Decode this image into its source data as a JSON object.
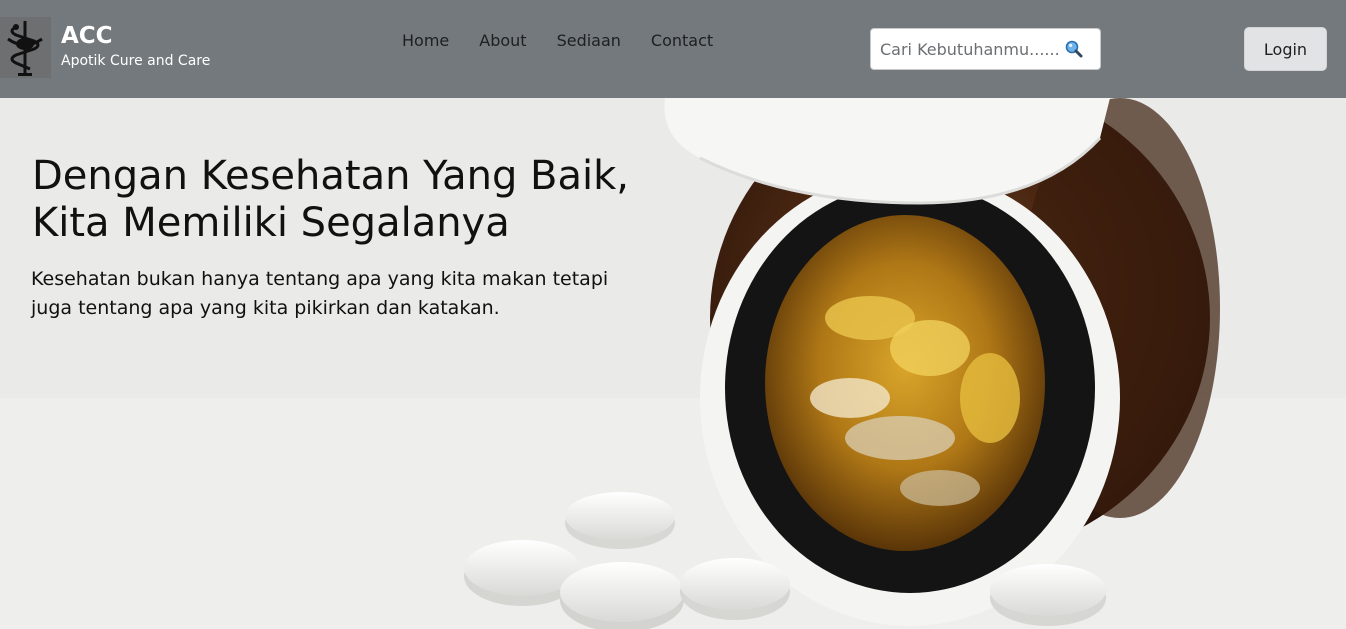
{
  "brand": {
    "logo_icon": "caduceus-icon",
    "name": "ACC",
    "tagline": "Apotik Cure and Care"
  },
  "nav": {
    "links": [
      "Home",
      "About",
      "Sediaan",
      "Contact"
    ]
  },
  "search": {
    "placeholder": "Cari Kebutuhanmu......",
    "icon": "search-icon"
  },
  "login": {
    "label": "Login"
  },
  "hero": {
    "title": "Dengan Kesehatan Yang Baik, Kita Memiliki Segalanya",
    "description": "Kesehatan bukan hanya tentang apa yang kita makan tetapi juga tentang apa yang kita pikirkan dan katakan."
  },
  "colors": {
    "navbar": "#74797d",
    "login_button": "#e1e3e4",
    "hero_background": "#ebebea"
  }
}
